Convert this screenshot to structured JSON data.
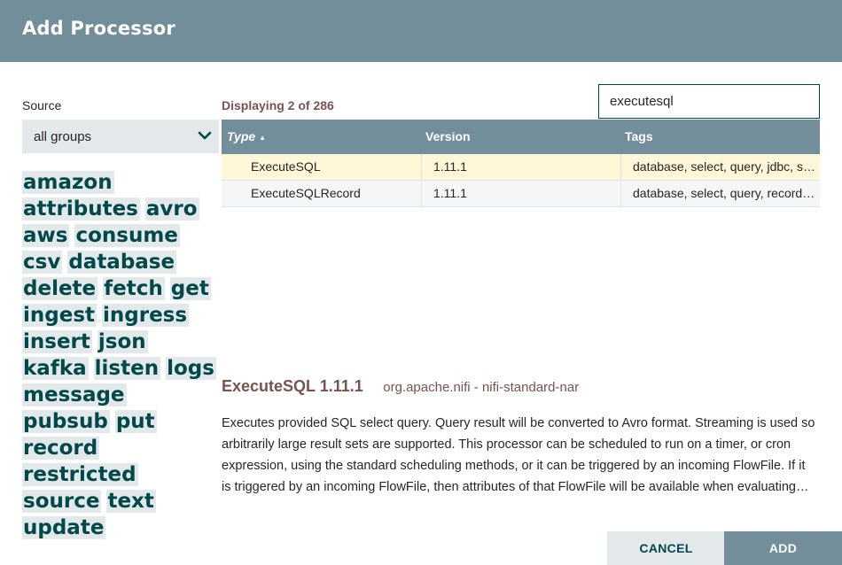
{
  "dialog": {
    "title": "Add Processor"
  },
  "source": {
    "label": "Source",
    "selected": "all groups"
  },
  "tags": [
    "amazon",
    "attributes",
    "avro",
    "aws",
    "consume",
    "csv",
    "database",
    "delete",
    "fetch",
    "get",
    "ingest",
    "ingress",
    "insert",
    "json",
    "kafka",
    "listen",
    "logs",
    "message",
    "pubsub",
    "put",
    "record",
    "restricted",
    "source",
    "text",
    "update"
  ],
  "status": {
    "displaying": "Displaying 2 of 286"
  },
  "search": {
    "value": "executesql",
    "placeholder": ""
  },
  "table": {
    "columns": {
      "type": "Type",
      "version": "Version",
      "tags": "Tags"
    },
    "sort": {
      "column": "Type",
      "direction": "ascending"
    },
    "rows": [
      {
        "type": "ExecuteSQL",
        "version": "1.11.1",
        "tags": "database, select, query, jdbc, sql, rdbms",
        "selected": true
      },
      {
        "type": "ExecuteSQLRecord",
        "version": "1.11.1",
        "tags": "database, select, query, record, jdbc, sql",
        "selected": false
      }
    ]
  },
  "detail": {
    "name": "ExecuteSQL 1.11.1",
    "bundle": "org.apache.nifi - nifi-standard-nar",
    "description": "Executes provided SQL select query. Query result will be converted to Avro format. Streaming is used so arbitrarily large result sets are supported. This processor can be scheduled to run on a timer, or cron expression, using the standard scheduling methods, or it can be triggered by an incoming FlowFile. If it is triggered by an incoming FlowFile, then attributes of that FlowFile will be available when evaluating the select query."
  },
  "buttons": {
    "cancel": "CANCEL",
    "add": "ADD"
  },
  "colors": {
    "header": "#728e9b",
    "accent": "#004849",
    "title": "#775351",
    "selected_row": "#fff7d7"
  }
}
